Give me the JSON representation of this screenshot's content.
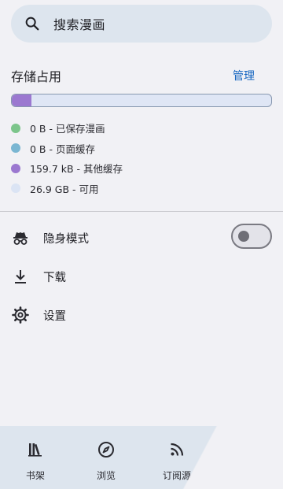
{
  "search": {
    "placeholder": "搜索漫画"
  },
  "storage": {
    "title": "存储占用",
    "manage_label": "管理",
    "used_fraction": 0.075,
    "legend": [
      {
        "text": "0 B - 已保存漫画",
        "color": "#7cc58b"
      },
      {
        "text": "0 B - 页面缓存",
        "color": "#7ab6d2"
      },
      {
        "text": "159.7 kB - 其他缓存",
        "color": "#9b78d0"
      },
      {
        "text": "26.9 GB - 可用",
        "color": "#dbe4f4"
      }
    ]
  },
  "menu": {
    "incognito": {
      "label": "隐身模式",
      "icon": "incognito-icon",
      "toggle_on": false
    },
    "download": {
      "label": "下载",
      "icon": "download-icon"
    },
    "settings": {
      "label": "设置",
      "icon": "gear-icon"
    }
  },
  "bottom_nav": [
    {
      "label": "书架",
      "icon": "library-icon"
    },
    {
      "label": "浏览",
      "icon": "compass-icon"
    },
    {
      "label": "订阅源",
      "icon": "rss-icon"
    }
  ],
  "colors": {
    "accent": "#1565c0",
    "surface": "#dde5ee",
    "background": "#f1f1f5"
  }
}
